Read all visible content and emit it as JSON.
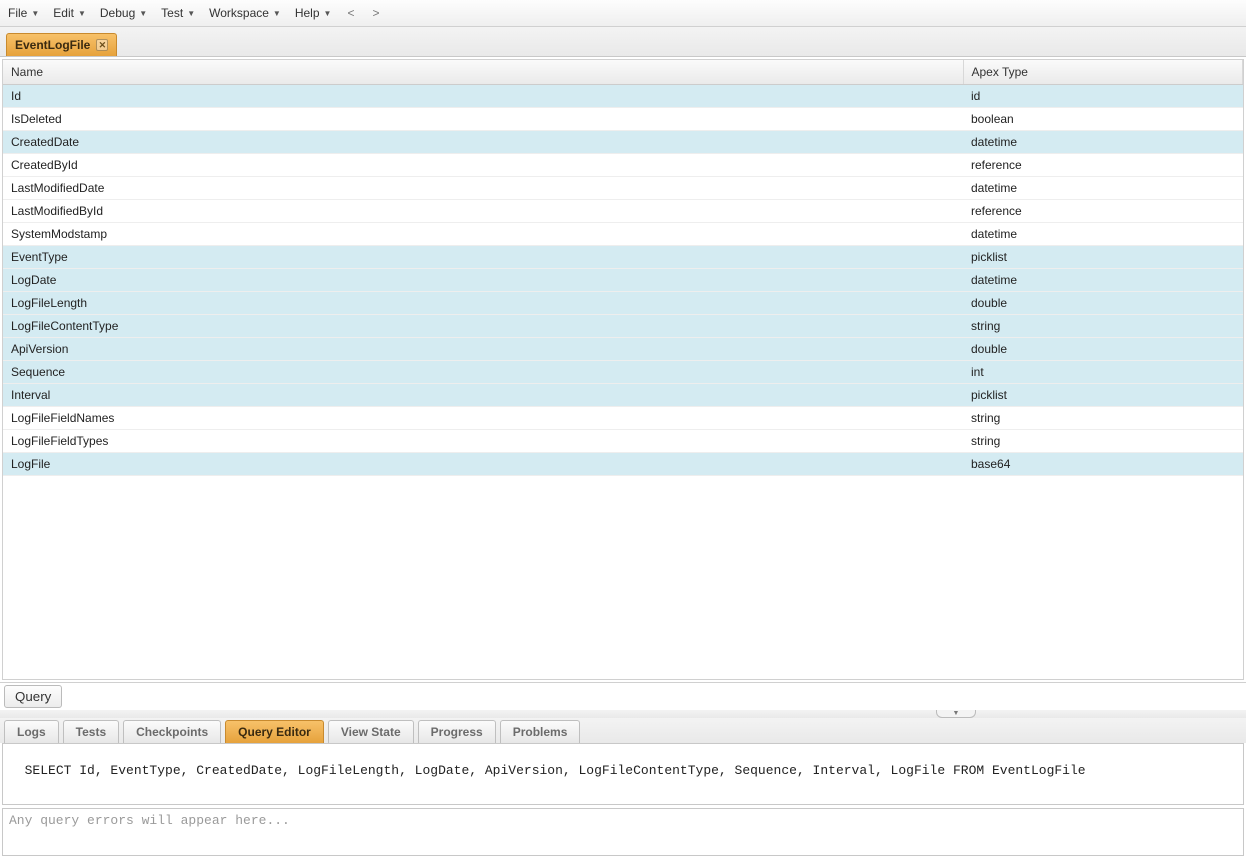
{
  "menubar": {
    "items": [
      "File",
      "Edit",
      "Debug",
      "Test",
      "Workspace",
      "Help"
    ],
    "nav_back": "<",
    "nav_forward": ">"
  },
  "doc_tab": {
    "label": "EventLogFile"
  },
  "table": {
    "columns": [
      "Name",
      "Apex Type"
    ],
    "rows": [
      {
        "name": "Id",
        "type": "id",
        "highlight": true
      },
      {
        "name": "IsDeleted",
        "type": "boolean",
        "highlight": false
      },
      {
        "name": "CreatedDate",
        "type": "datetime",
        "highlight": true
      },
      {
        "name": "CreatedById",
        "type": "reference",
        "highlight": false
      },
      {
        "name": "LastModifiedDate",
        "type": "datetime",
        "highlight": false
      },
      {
        "name": "LastModifiedById",
        "type": "reference",
        "highlight": false
      },
      {
        "name": "SystemModstamp",
        "type": "datetime",
        "highlight": false
      },
      {
        "name": "EventType",
        "type": "picklist",
        "highlight": true
      },
      {
        "name": "LogDate",
        "type": "datetime",
        "highlight": true
      },
      {
        "name": "LogFileLength",
        "type": "double",
        "highlight": true
      },
      {
        "name": "LogFileContentType",
        "type": "string",
        "highlight": true
      },
      {
        "name": "ApiVersion",
        "type": "double",
        "highlight": true
      },
      {
        "name": "Sequence",
        "type": "int",
        "highlight": true
      },
      {
        "name": "Interval",
        "type": "picklist",
        "highlight": true
      },
      {
        "name": "LogFileFieldNames",
        "type": "string",
        "highlight": false
      },
      {
        "name": "LogFileFieldTypes",
        "type": "string",
        "highlight": false
      },
      {
        "name": "LogFile",
        "type": "base64",
        "highlight": true
      }
    ]
  },
  "query_button": "Query",
  "bottom_tabs": {
    "items": [
      "Logs",
      "Tests",
      "Checkpoints",
      "Query Editor",
      "View State",
      "Progress",
      "Problems"
    ],
    "active_index": 3
  },
  "query_editor_text": "SELECT Id, EventType, CreatedDate, LogFileLength, LogDate, ApiVersion, LogFileContentType, Sequence, Interval, LogFile FROM EventLogFile",
  "errors_placeholder": "Any query errors will appear here..."
}
